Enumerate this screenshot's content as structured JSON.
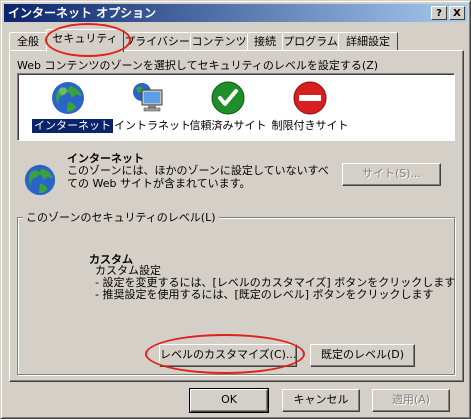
{
  "window": {
    "title": "インターネット オプション",
    "help_button": "?",
    "close_button": "X"
  },
  "tabs": [
    {
      "label": "全般",
      "active": false
    },
    {
      "label": "セキュリティ",
      "active": true
    },
    {
      "label": "プライバシー",
      "active": false
    },
    {
      "label": "コンテンツ",
      "active": false
    },
    {
      "label": "接続",
      "active": false
    },
    {
      "label": "プログラム",
      "active": false
    },
    {
      "label": "詳細設定",
      "active": false
    }
  ],
  "zones": {
    "instruction": "Web コンテンツのゾーンを選択してセキュリティのレベルを設定する(Z)",
    "items": [
      {
        "label": "インターネット",
        "icon": "globe-icon",
        "selected": true
      },
      {
        "label": "イントラネット",
        "icon": "network-computer-icon",
        "selected": false
      },
      {
        "label": "信頼済みサイト",
        "icon": "green-check-icon",
        "selected": false
      },
      {
        "label": "制限付きサイト",
        "icon": "red-no-entry-icon",
        "selected": false
      }
    ]
  },
  "zone_info": {
    "title": "インターネット",
    "description": "このゾーンには、ほかのゾーンに設定していないすべての Web サイトが含まれています。",
    "sites_button": "サイト(S)..."
  },
  "security_level": {
    "group_title": "このゾーンのセキュリティのレベル(L)",
    "custom_title": "カスタム",
    "lines": [
      "カスタム設定",
      "- 設定を変更するには、[レベルのカスタマイズ] ボタンをクリックします",
      "- 推奨設定を使用するには、[既定のレベル] ボタンをクリックします"
    ],
    "customize_button": "レベルのカスタマイズ(C)...",
    "default_button": "既定のレベル(D)"
  },
  "footer": {
    "ok": "OK",
    "cancel": "キャンセル",
    "apply": "適用(A)"
  },
  "colors": {
    "titlebar_start": "#0a246a",
    "titlebar_end": "#a6caf0",
    "face": "#d4d0c8",
    "selection": "#0a246a",
    "annotation_red": "#e0201a"
  }
}
